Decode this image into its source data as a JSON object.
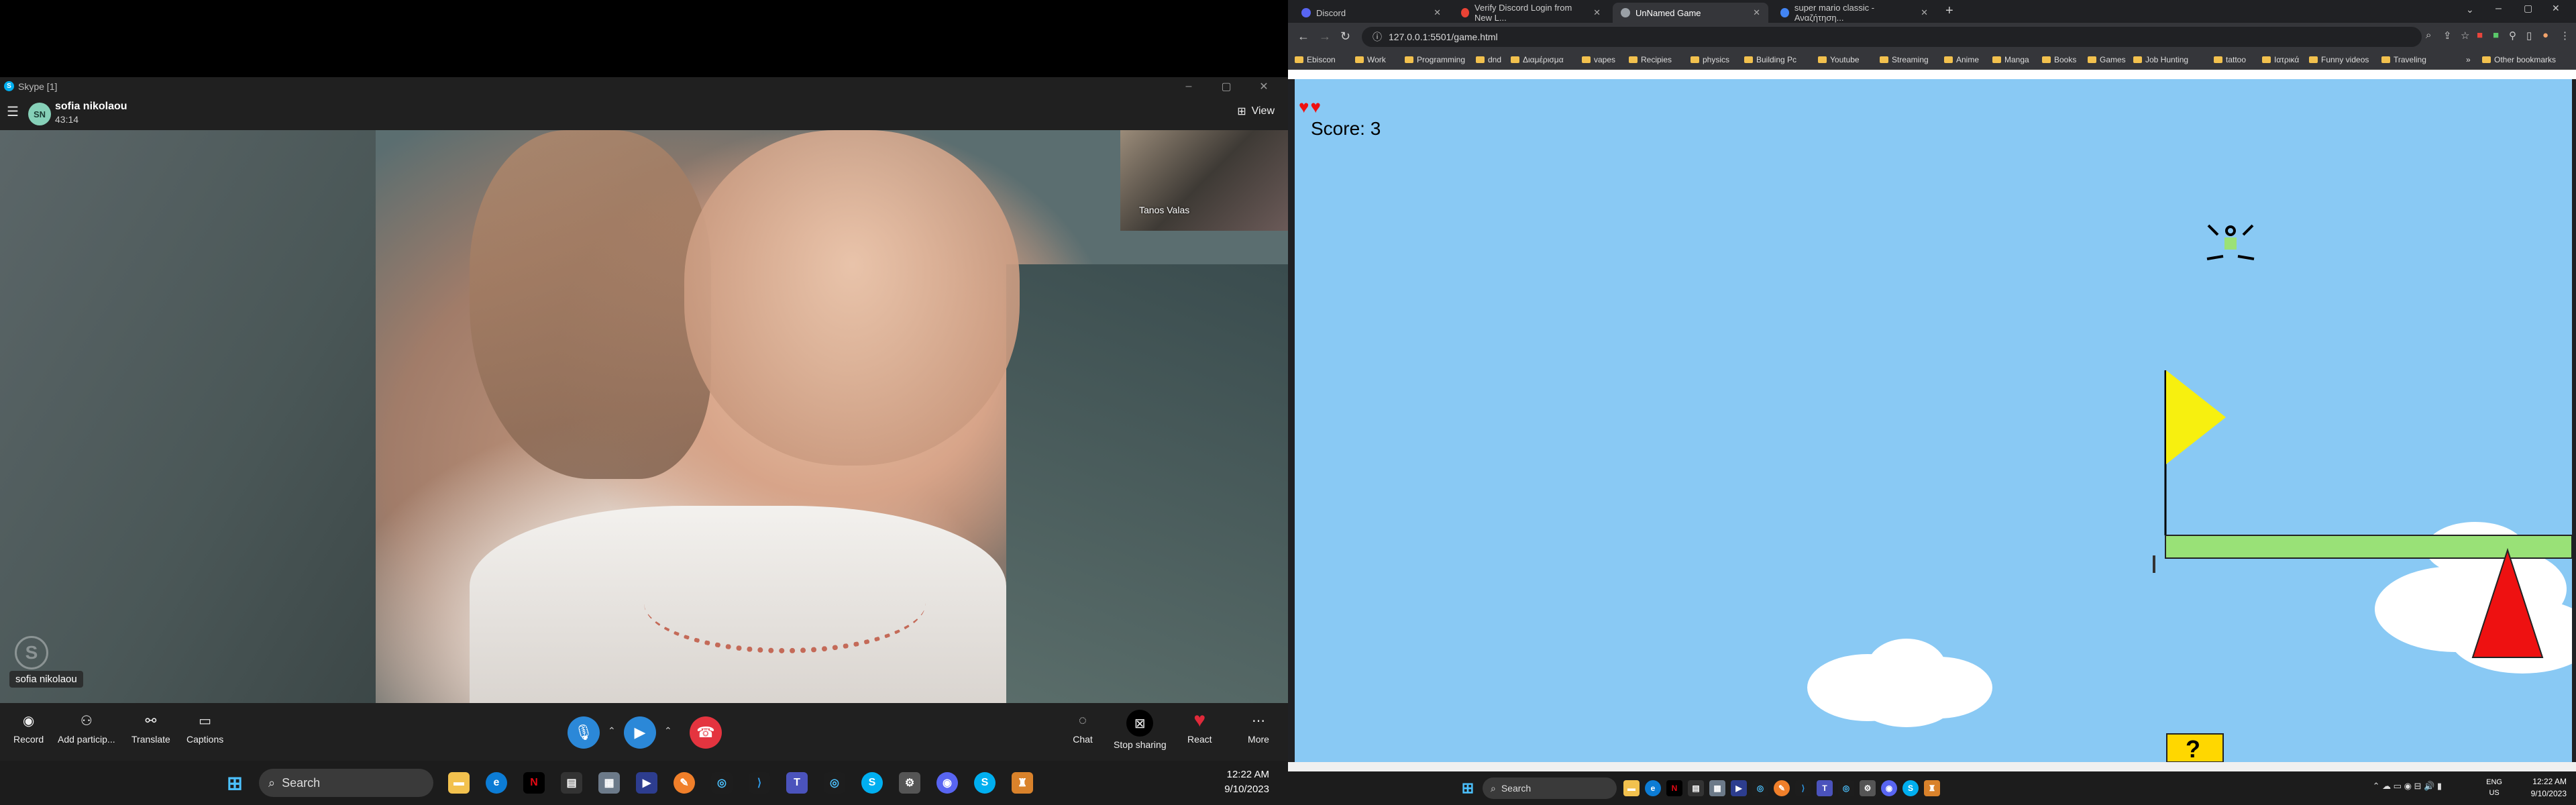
{
  "skype": {
    "window_title": "Skype [1]",
    "avatar_initials": "SN",
    "contact_name": "sofia nikolaou",
    "call_duration": "43:14",
    "view_label": "View",
    "self_view_name": "Tanos Valas",
    "participant_tag": "sofia nikolaou",
    "controls": {
      "record": "Record",
      "add_participants": "Add particip...",
      "translate": "Translate",
      "captions": "Captions",
      "chat": "Chat",
      "stop_sharing": "Stop sharing",
      "react": "React",
      "more": "More"
    }
  },
  "taskbar_left": {
    "search_placeholder": "Search",
    "time": "12:22 AM",
    "date": "9/10/2023"
  },
  "chrome": {
    "tabs": [
      {
        "label": "Discord",
        "color": "#5865f2"
      },
      {
        "label": "Verify Discord Login from New L...",
        "color": "#ea4335"
      },
      {
        "label": "UnNamed Game",
        "color": "#9aa0a6"
      },
      {
        "label": "super mario classic - Αναζήτηση...",
        "color": "#4285f4"
      }
    ],
    "url": "127.0.0.1:5501/game.html",
    "bookmarks": [
      "Ebiscon",
      "Work",
      "Programming",
      "dnd",
      "Διαμέρισμα",
      "vapes",
      "Recipies",
      "physics",
      "Building Pc",
      "Youtube",
      "Streaming",
      "Anime",
      "Manga",
      "Books",
      "Games",
      "Job Hunting",
      "tattoo",
      "Ιατρικά",
      "Funny videos",
      "Traveling"
    ],
    "other_bookmarks": "Other bookmarks"
  },
  "game": {
    "lives": 2,
    "score_text": "Score: 3",
    "question_block": "?",
    "colors": {
      "sky": "#89c9f4",
      "platform": "#99e177",
      "flag": "#f7f00f",
      "spike": "#ee1111",
      "block": "#ffd700"
    }
  },
  "taskbar_right": {
    "search_placeholder": "Search",
    "lang": "ENG",
    "region": "US",
    "time": "12:22 AM",
    "date": "9/10/2023"
  }
}
